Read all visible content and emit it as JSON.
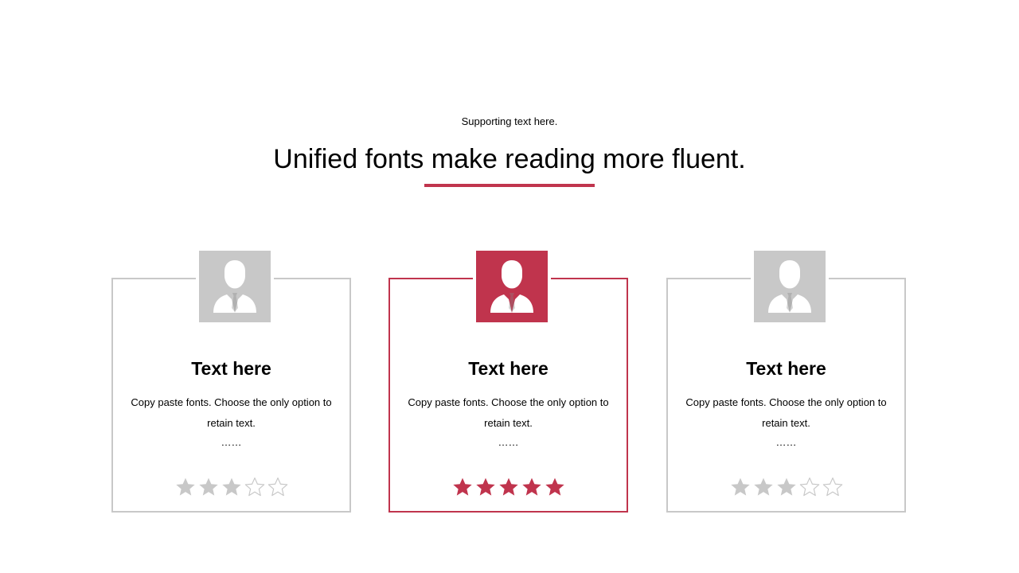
{
  "header": {
    "subtitle": "Supporting text here.",
    "title": "Unified fonts make reading more fluent."
  },
  "colors": {
    "accent": "#c0344d",
    "muted": "#c8c8c8",
    "text": "#000000"
  },
  "cards": [
    {
      "icon": "businessman-icon",
      "highlighted": false,
      "title": "Text here",
      "body": "Copy paste fonts. Choose the only option to retain text.",
      "dots": "……",
      "rating": 3,
      "rating_max": 5
    },
    {
      "icon": "businessman-icon",
      "highlighted": true,
      "title": "Text here",
      "body": "Copy paste fonts. Choose the only option to retain text.",
      "dots": "……",
      "rating": 5,
      "rating_max": 5
    },
    {
      "icon": "businessman-icon",
      "highlighted": false,
      "title": "Text here",
      "body": "Copy paste fonts. Choose the only option to retain text.",
      "dots": "……",
      "rating": 3,
      "rating_max": 5
    }
  ]
}
